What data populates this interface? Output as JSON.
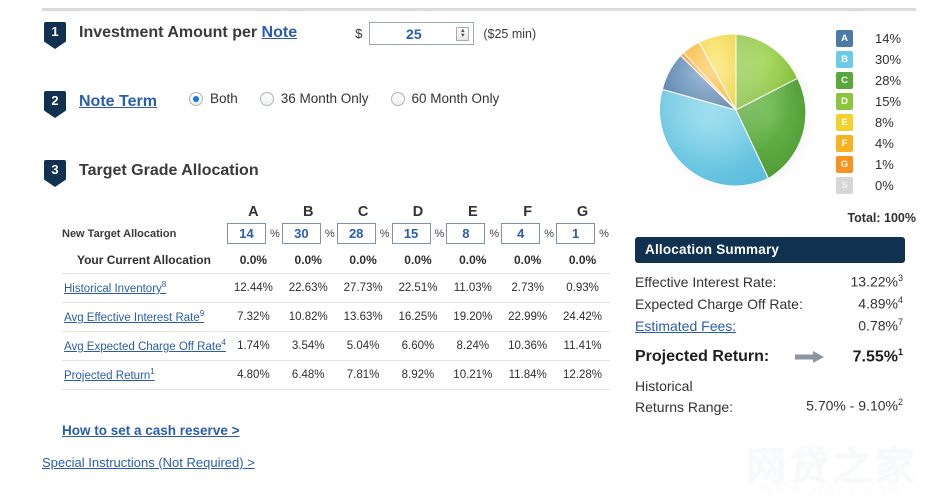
{
  "steps": {
    "one": {
      "number": "1",
      "title_prefix": "Investment Amount per ",
      "title_link": "Note",
      "currency": "$",
      "amount_value": "25",
      "amount_placeholder": "25",
      "min_note": "($25 min)"
    },
    "two": {
      "number": "2",
      "title": "Note Term",
      "options": [
        {
          "label": "Both",
          "selected": true
        },
        {
          "label": "36 Month Only",
          "selected": false
        },
        {
          "label": "60 Month Only",
          "selected": false
        }
      ]
    },
    "three": {
      "number": "3",
      "title": "Target Grade Allocation"
    }
  },
  "table": {
    "grades": [
      "A",
      "B",
      "C",
      "D",
      "E",
      "F",
      "G"
    ],
    "rows": [
      {
        "label": "New Target Allocation",
        "sup": "",
        "link": false,
        "type": "input",
        "values": [
          "14",
          "30",
          "28",
          "15",
          "8",
          "4",
          "1"
        ],
        "unit": "%"
      },
      {
        "label": "Your Current Allocation",
        "sup": "",
        "link": false,
        "type": "text-bold",
        "values": [
          "0.0%",
          "0.0%",
          "0.0%",
          "0.0%",
          "0.0%",
          "0.0%",
          "0.0%"
        ]
      },
      {
        "label": "Historical Inventory",
        "sup": "8",
        "link": true,
        "type": "text",
        "values": [
          "12.44%",
          "22.63%",
          "27.73%",
          "22.51%",
          "11.03%",
          "2.73%",
          "0.93%"
        ]
      },
      {
        "label": "Avg Effective Interest Rate",
        "sup": "9",
        "link": true,
        "type": "text",
        "values": [
          "7.32%",
          "10.82%",
          "13.63%",
          "16.25%",
          "19.20%",
          "22.99%",
          "24.42%"
        ]
      },
      {
        "label": "Avg Expected Charge Off Rate",
        "sup": "4",
        "link": true,
        "type": "text",
        "values": [
          "1.74%",
          "3.54%",
          "5.04%",
          "6.60%",
          "8.24%",
          "10.36%",
          "11.41%"
        ]
      },
      {
        "label": "Projected Return",
        "sup": "1",
        "link": true,
        "type": "text",
        "values": [
          "4.80%",
          "6.48%",
          "7.81%",
          "8.92%",
          "10.21%",
          "11.84%",
          "12.28%"
        ]
      }
    ]
  },
  "links": {
    "cash_reserve": "How to set a cash reserve >",
    "special_instructions": "Special Instructions (Not Required) >"
  },
  "legend": {
    "items": [
      {
        "grade": "A",
        "pct": "14%",
        "color": "#4a7ba7"
      },
      {
        "grade": "B",
        "pct": "30%",
        "color": "#6ecbe8"
      },
      {
        "grade": "C",
        "pct": "28%",
        "color": "#5aa83c"
      },
      {
        "grade": "D",
        "pct": "15%",
        "color": "#8cc63e"
      },
      {
        "grade": "E",
        "pct": "8%",
        "color": "#f2d32e"
      },
      {
        "grade": "F",
        "pct": "4%",
        "color": "#f6b221"
      },
      {
        "grade": "G",
        "pct": "1%",
        "color": "#f7921e"
      },
      {
        "grade": "S",
        "pct": "0%",
        "color": "#d6d6d6"
      }
    ],
    "total": "Total: 100%"
  },
  "summary": {
    "header": "Allocation Summary",
    "lines": [
      {
        "label": "Effective Interest Rate:",
        "value": "13.22%",
        "sup": "3",
        "link": false
      },
      {
        "label": "Expected Charge Off Rate:",
        "value": "4.89%",
        "sup": "4",
        "link": false
      },
      {
        "label": "Estimated Fees:",
        "value": "0.78%",
        "sup": "7",
        "link": true
      }
    ],
    "projected": {
      "label": "Projected Return:",
      "value": "7.55%",
      "sup": "1"
    },
    "historical": {
      "label_line1": "Historical",
      "label_line2": "Returns Range:",
      "value": "5.70% - 9.10%",
      "sup": "2"
    }
  },
  "watermark": {
    "cn": "网贷之家",
    "en": "WWW.WDZJ.COM"
  },
  "chart_data": {
    "type": "pie",
    "title": "Target Grade Allocation",
    "categories": [
      "A",
      "B",
      "C",
      "D",
      "E",
      "F",
      "G",
      "S"
    ],
    "values": [
      14,
      30,
      28,
      15,
      8,
      4,
      1,
      0
    ],
    "colors": [
      "#4a7ba7",
      "#6ecbe8",
      "#5aa83c",
      "#8cc63e",
      "#f2d32e",
      "#f6b221",
      "#f7921e",
      "#d6d6d6"
    ],
    "unit": "%",
    "total": 100,
    "legend_position": "right",
    "start_angle_deg": -90,
    "direction": "counterclockwise"
  }
}
